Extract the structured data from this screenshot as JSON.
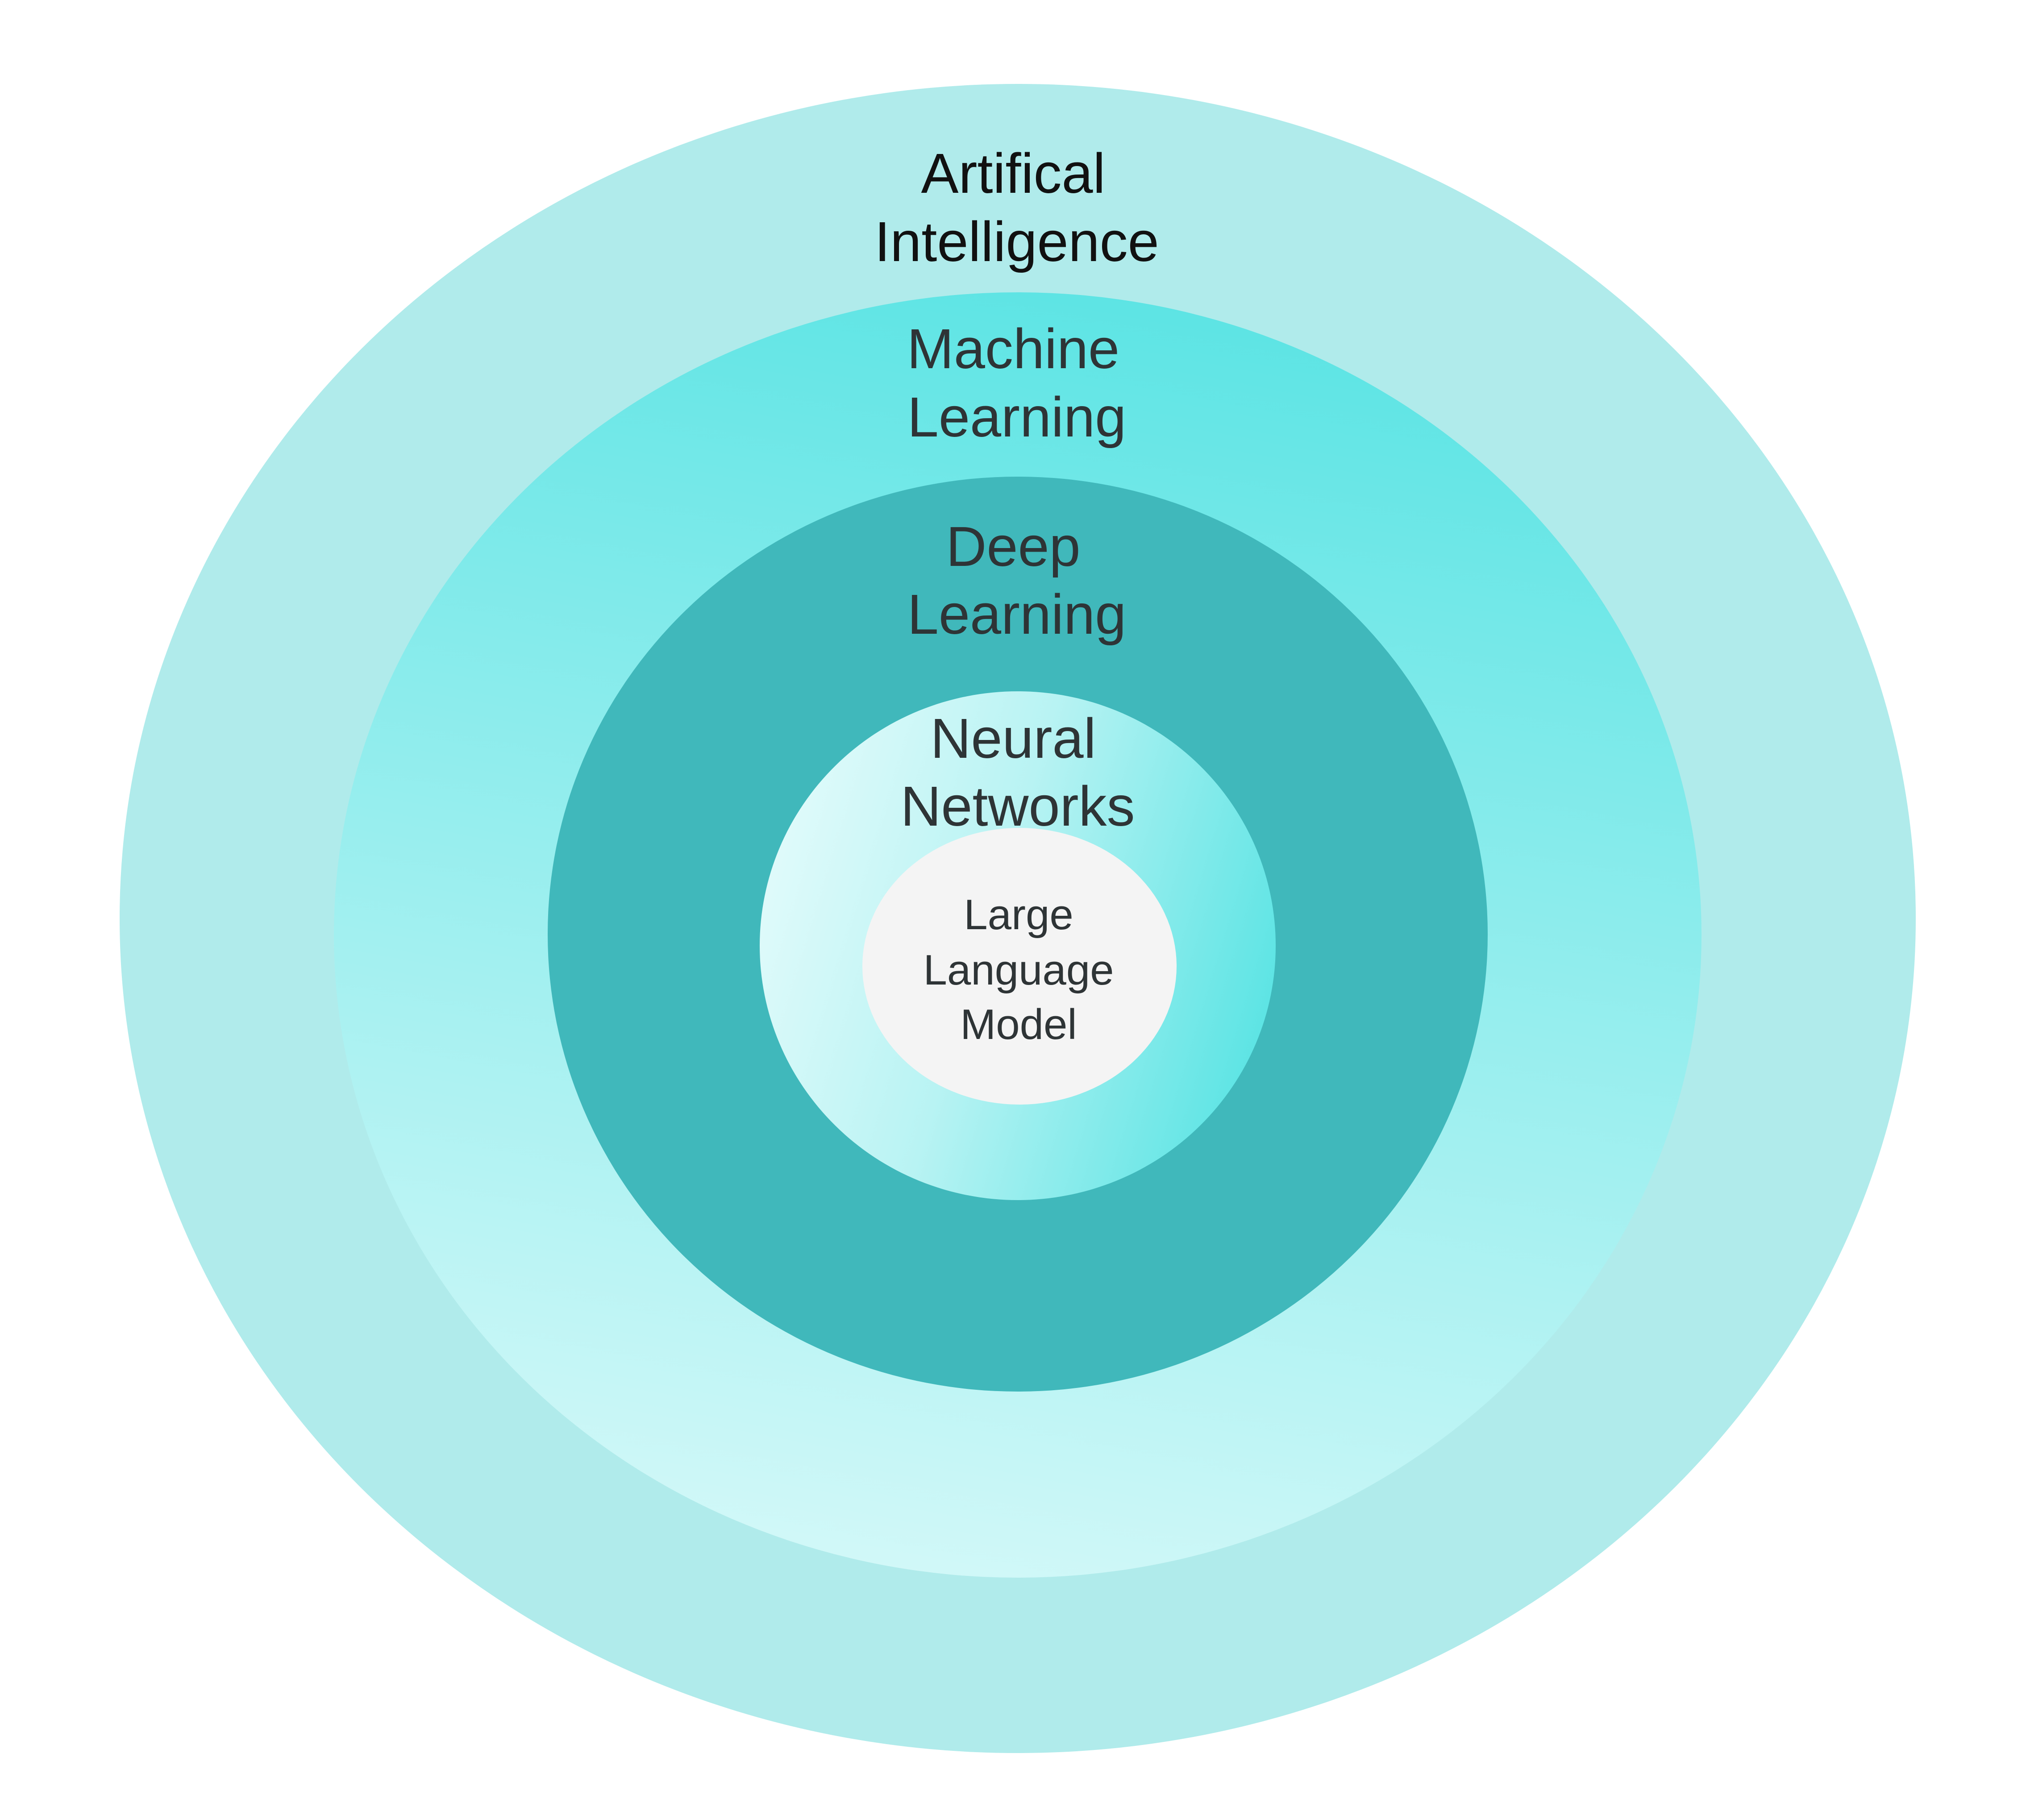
{
  "diagram": {
    "colors": {
      "background": "#ffffff",
      "ai_ring": "#b0ebeb",
      "ml_ring_top": "#5ce4e4",
      "ml_ring_bottom": "#d2f8f8",
      "dl_ring": "#40b8bb",
      "nn_ring_light": "#e2fbfb",
      "nn_ring_dark": "#5ce4e4",
      "llm_core": "#f4f4f4",
      "text_dark": "#2e3436",
      "text_black": "#111111"
    },
    "layers": [
      {
        "id": "ai",
        "lines": [
          "Artifical",
          "Intelligence"
        ]
      },
      {
        "id": "ml",
        "lines": [
          "Machine",
          "Learning"
        ]
      },
      {
        "id": "dl",
        "lines": [
          "Deep",
          "Learning"
        ]
      },
      {
        "id": "nn",
        "lines": [
          "Neural",
          "Networks"
        ]
      },
      {
        "id": "llm",
        "lines": [
          "Large",
          "Language",
          "Model"
        ]
      }
    ]
  }
}
